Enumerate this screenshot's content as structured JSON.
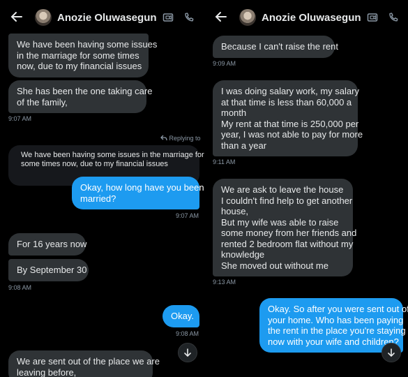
{
  "contact_name": "Anozie Oluwasegun",
  "left_panel": {
    "messages": [
      {
        "lines": [
          "We have been having some issues",
          "in the marriage for some times",
          "now, due to my financial issues"
        ]
      },
      {
        "lines": [
          "She has been the one taking care",
          "of the family,"
        ]
      },
      {
        "timestamp": "9:07 AM"
      },
      {
        "reply_label": "Replying to"
      },
      {
        "quote_lines": [
          "We have been having some issues in the marriage for",
          "some times now, due to my financial issues"
        ]
      },
      {
        "lines": [
          "Okay, how long have you been",
          "married?"
        ]
      },
      {
        "timestamp": "9:07 AM"
      },
      {
        "lines": [
          "For 16 years now"
        ]
      },
      {
        "lines": [
          "By September 30"
        ]
      },
      {
        "timestamp": "9:08 AM"
      },
      {
        "lines": [
          "Okay."
        ]
      },
      {
        "timestamp": "9:08 AM"
      },
      {
        "lines": [
          "We are sent out of the place we are",
          "leaving before,"
        ]
      }
    ]
  },
  "right_panel": {
    "messages": [
      {
        "lines": [
          "Because I can't raise the rent"
        ]
      },
      {
        "timestamp": "9:09 AM"
      },
      {
        "lines": [
          "I was doing salary work, my salary",
          "at that time is less than 60,000 a",
          "month",
          "My rent at that time is 250,000 per",
          "year, I was not able to pay for more",
          "than a year"
        ]
      },
      {
        "timestamp": "9:11 AM"
      },
      {
        "lines": [
          "We are ask to leave the house",
          "I couldn't find help to get another",
          "house,",
          "But my wife was able to raise",
          "some money from her friends and",
          "rented 2 bedroom flat without my",
          "knowledge",
          "She moved out without me"
        ]
      },
      {
        "timestamp": "9:13 AM"
      },
      {
        "lines": [
          "Okay. So after you were sent out of",
          "your home. Who has been paying",
          "the rent in the place you're staying",
          "now with your wife and children?"
        ]
      }
    ]
  },
  "colors": {
    "incoming": "#2f3336",
    "outgoing": "#1d9bf0",
    "quote": "#16181c",
    "timestamp": "#8b98a5"
  },
  "icons": [
    "back-arrow-icon",
    "video-call-icon",
    "phone-icon",
    "reply-arrow-icon",
    "chevron-down-icon"
  ]
}
